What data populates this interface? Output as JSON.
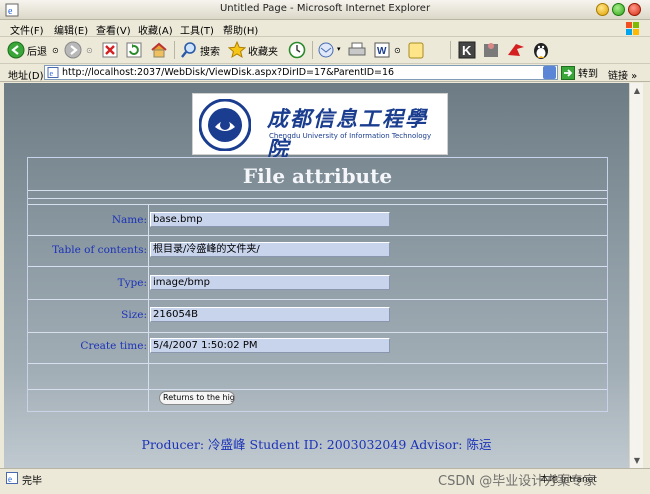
{
  "window": {
    "title": "Untitled Page - Microsoft Internet Explorer"
  },
  "menu": [
    "文件(F)",
    "编辑(E)",
    "查看(V)",
    "收藏(A)",
    "工具(T)",
    "帮助(H)"
  ],
  "toolbar": {
    "back_label": "后退",
    "search_label": "搜索",
    "favorites_label": "收藏夹"
  },
  "address": {
    "label": "地址(D)",
    "url": "http://localhost:2037/WebDisk/ViewDisk.aspx?DirID=17&ParentID=16",
    "go_label": "转到",
    "links_label": "链接"
  },
  "logo": {
    "cn": "成都信息工程學院",
    "en": "Chengdu University of Information Technology"
  },
  "page": {
    "title": "File attribute",
    "fields": [
      {
        "label": "Name:",
        "value": "base.bmp"
      },
      {
        "label": "Table of contents:",
        "value": "根目录/冷盛峰的文件夹/"
      },
      {
        "label": "Type:",
        "value": "image/bmp"
      },
      {
        "label": "Size:",
        "value": "216054B"
      },
      {
        "label": "Create time:",
        "value": "5/4/2007 1:50:02 PM"
      }
    ],
    "return_button": "Returns to the highe",
    "footer": "Producer: 冷盛峰  Student ID: 2003032049  Advisor: 陈运"
  },
  "status": {
    "text": "完毕",
    "zone": "本地 Intranet",
    "watermark": "CSDN @毕业设计方案专家"
  },
  "colors": {
    "label_blue": "#1c33b8",
    "field_bg": "#c8d4ec",
    "page_bg_top": "#6d7b84",
    "page_bg_bottom": "#c0c9d0"
  }
}
